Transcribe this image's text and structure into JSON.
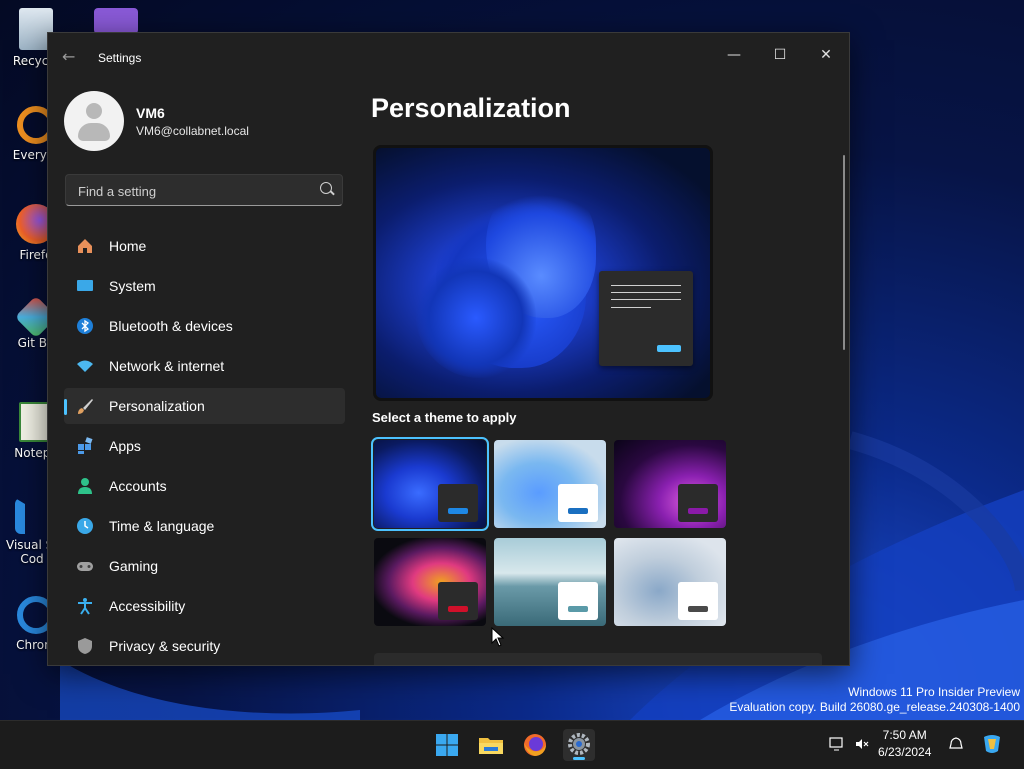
{
  "desktop": {
    "icons": [
      {
        "label": "Recycle"
      },
      {
        "label": "Everyth"
      },
      {
        "label": "Firefo"
      },
      {
        "label": "Git Ba"
      },
      {
        "label": "Notepa"
      },
      {
        "label": "Visual St"
      },
      {
        "label": "Cod"
      },
      {
        "label": "Chrom"
      }
    ],
    "watermark_line1": "Windows 11 Pro Insider Preview",
    "watermark_line2": "Evaluation copy. Build 26080.ge_release.240308-1400"
  },
  "window": {
    "title": "Settings",
    "back_icon": "back-arrow-icon",
    "controls": {
      "minimize": "—",
      "maximize": "☐",
      "close": "✕"
    }
  },
  "user": {
    "name": "VM6",
    "email": "VM6@collabnet.local"
  },
  "search": {
    "placeholder": "Find a setting"
  },
  "sidebar": {
    "items": [
      {
        "label": "Home",
        "icon": "home-icon",
        "color": "#e8905a"
      },
      {
        "label": "System",
        "icon": "system-icon",
        "color": "#3aa8e8"
      },
      {
        "label": "Bluetooth & devices",
        "icon": "bluetooth-icon",
        "color": "#1e7fd8"
      },
      {
        "label": "Network & internet",
        "icon": "network-icon",
        "color": "#4cb8f0"
      },
      {
        "label": "Personalization",
        "icon": "brush-icon",
        "color": "#e0a060",
        "active": true
      },
      {
        "label": "Apps",
        "icon": "apps-icon",
        "color": "#4c9ae8"
      },
      {
        "label": "Accounts",
        "icon": "accounts-icon",
        "color": "#2ec28a"
      },
      {
        "label": "Time & language",
        "icon": "time-language-icon",
        "color": "#3aa8e8"
      },
      {
        "label": "Gaming",
        "icon": "gaming-icon",
        "color": "#a0a0a0"
      },
      {
        "label": "Accessibility",
        "icon": "accessibility-icon",
        "color": "#3ab0f0"
      },
      {
        "label": "Privacy & security",
        "icon": "shield-icon",
        "color": "#9a9a9a"
      }
    ]
  },
  "content": {
    "title": "Personalization",
    "theme_section_label": "Select a theme to apply",
    "themes": [
      {
        "name": "windows-dark",
        "accent": "#1e88e5",
        "selected": true
      },
      {
        "name": "windows-light",
        "accent": "#1a6fc0",
        "selected": false
      },
      {
        "name": "glow",
        "accent": "#8a1aa8",
        "selected": false
      },
      {
        "name": "captured-motion",
        "accent": "#d0102a",
        "selected": false
      },
      {
        "name": "sunrise",
        "accent": "#5a9aa8",
        "selected": false
      },
      {
        "name": "flow",
        "accent": "#4a4a4a",
        "selected": false
      }
    ]
  },
  "taskbar": {
    "apps": [
      {
        "icon": "windows-start-icon"
      },
      {
        "icon": "file-explorer-icon"
      },
      {
        "icon": "firefox-icon"
      },
      {
        "icon": "settings-gear-icon",
        "active": true
      }
    ],
    "time": "7:50 AM",
    "date": "6/23/2024"
  },
  "colors": {
    "accent": "#4cc2ff",
    "window_bg": "#202020"
  }
}
